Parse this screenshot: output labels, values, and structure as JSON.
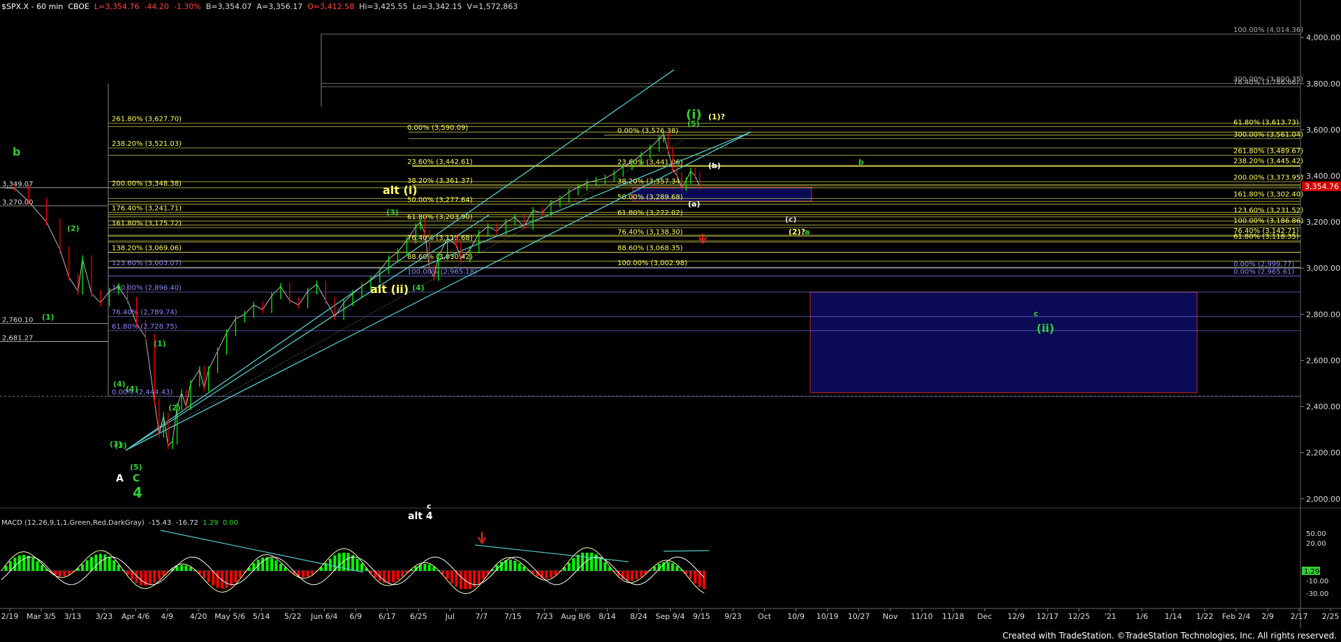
{
  "header": {
    "symbol": "$SPX.X - 60 min  CBOE",
    "last": "L=3,354.76",
    "change": "-44.20",
    "pct": "-1.30%",
    "bid": "B=3,354.07",
    "ask": "A=3,356.17",
    "open": "O=3,412.58",
    "high": "Hi=3,425.55",
    "low": "Lo=3,342.15",
    "volume": "V=1,572,863"
  },
  "macd": {
    "title": "MACD (12,26,9,1,1,Green,Red,DarkGray)",
    "v1": "-15.43",
    "v2": "-16.72",
    "v3": "1.29",
    "v4": "0.00",
    "axis_ticks": [
      "50.00",
      "20.00",
      "-10.00",
      "-30.00"
    ],
    "current_label": "1.29"
  },
  "footer": "Created with TradeStation. ©TradeStation Technologies, Inc. All rights reserved.",
  "colors": {
    "price_up": "#00ff00",
    "price_down": "#ff0000",
    "fib": "#ffff66",
    "fib_blue": "#8888ff",
    "cyan": "#55cccc",
    "wave_green": "#33cc33",
    "box_fill": "#0b0b55",
    "box_edge": "#cc2222"
  },
  "chart_data": {
    "type": "line",
    "x_ticks": [
      "2/19",
      "Mar 3/5",
      "3/13",
      "3/23",
      "Apr 4/6",
      "4/9",
      "4/20",
      "May 5/6",
      "5/14",
      "5/22",
      "Jun 6/4",
      "6/9",
      "6/17",
      "6/25",
      "Jul",
      "7/7",
      "7/15",
      "7/23",
      "Aug 8/6",
      "8/14",
      "8/24",
      "Sep 9/4",
      "9/15",
      "9/23",
      "Oct",
      "10/9",
      "10/19",
      "10/27",
      "Nov",
      "11/10",
      "11/18",
      "Dec",
      "12/9",
      "12/17",
      "12/25",
      "'21",
      "1/6",
      "1/14",
      "1/22",
      "Feb 2/4",
      "2/9",
      "2/17",
      "2/25"
    ],
    "y_ticks": [
      "4,000.00",
      "3,800.00",
      "3,600.00",
      "3,400.00",
      "3,200.00",
      "3,000.00",
      "2,800.00",
      "2,600.00",
      "2,400.00",
      "2,200.00",
      "2,000.00"
    ],
    "ylim": [
      1960,
      4120
    ],
    "last_price": "3,354.76",
    "price_path": [
      [
        0,
        3349
      ],
      [
        3,
        3345
      ],
      [
        6,
        3290
      ],
      [
        10,
        3200
      ],
      [
        13,
        3080
      ],
      [
        15,
        2960
      ],
      [
        17,
        2900
      ],
      [
        18,
        3040
      ],
      [
        20,
        2890
      ],
      [
        22,
        2850
      ],
      [
        24,
        2900
      ],
      [
        26,
        2920
      ],
      [
        28,
        2860
      ],
      [
        30,
        2760
      ],
      [
        32,
        2700
      ],
      [
        34,
        2420
      ],
      [
        35,
        2280
      ],
      [
        36,
        2360
      ],
      [
        37,
        2230
      ],
      [
        38,
        2250
      ],
      [
        39,
        2400
      ],
      [
        40,
        2460
      ],
      [
        41,
        2400
      ],
      [
        42,
        2500
      ],
      [
        44,
        2560
      ],
      [
        45,
        2480
      ],
      [
        46,
        2560
      ],
      [
        48,
        2640
      ],
      [
        50,
        2720
      ],
      [
        52,
        2780
      ],
      [
        54,
        2800
      ],
      [
        56,
        2840
      ],
      [
        58,
        2820
      ],
      [
        60,
        2880
      ],
      [
        62,
        2920
      ],
      [
        64,
        2860
      ],
      [
        66,
        2840
      ],
      [
        68,
        2900
      ],
      [
        70,
        2930
      ],
      [
        72,
        2860
      ],
      [
        74,
        2790
      ],
      [
        76,
        2850
      ],
      [
        78,
        2890
      ],
      [
        80,
        2920
      ],
      [
        82,
        2950
      ],
      [
        84,
        2990
      ],
      [
        86,
        3040
      ],
      [
        88,
        3070
      ],
      [
        90,
        3120
      ],
      [
        92,
        3180
      ],
      [
        93,
        3200
      ],
      [
        94,
        3150
      ],
      [
        95,
        3000
      ],
      [
        96,
        2960
      ],
      [
        97,
        3050
      ],
      [
        99,
        3130
      ],
      [
        101,
        3100
      ],
      [
        102,
        3040
      ],
      [
        104,
        3080
      ],
      [
        106,
        3150
      ],
      [
        108,
        3180
      ],
      [
        110,
        3160
      ],
      [
        112,
        3200
      ],
      [
        114,
        3220
      ],
      [
        116,
        3180
      ],
      [
        118,
        3250
      ],
      [
        120,
        3240
      ],
      [
        122,
        3280
      ],
      [
        124,
        3300
      ],
      [
        126,
        3330
      ],
      [
        128,
        3350
      ],
      [
        130,
        3370
      ],
      [
        132,
        3380
      ],
      [
        134,
        3390
      ],
      [
        136,
        3410
      ],
      [
        138,
        3440
      ],
      [
        140,
        3460
      ],
      [
        142,
        3490
      ],
      [
        144,
        3520
      ],
      [
        146,
        3560
      ],
      [
        147,
        3580
      ],
      [
        148,
        3510
      ],
      [
        149,
        3430
      ],
      [
        150,
        3400
      ],
      [
        151,
        3350
      ],
      [
        152,
        3380
      ],
      [
        153,
        3420
      ],
      [
        154,
        3400
      ],
      [
        155,
        3355
      ]
    ],
    "fib_levels": [
      {
        "label": "100.00% (4,014.36)",
        "value": 4014.36
      },
      {
        "label": "300.00% (3,800.35)",
        "value": 3800.35
      },
      {
        "label": "76.40% (3,786.66)",
        "value": 3786.66
      },
      {
        "label": "261.80% (3,627.70)",
        "value": 3627.7
      },
      {
        "label": "61.80% (3,613.73)",
        "value": 3613.73
      },
      {
        "label": "0.00% (3,590.09)",
        "value": 3590.09
      },
      {
        "label": "0.00% (3,576.38)",
        "value": 3576.38
      },
      {
        "label": "300.00% (3,561.04)",
        "value": 3561.04
      },
      {
        "label": "238.20% (3,521.03)",
        "value": 3521.03
      },
      {
        "label": "261.80% (3,489.67)",
        "value": 3489.67
      },
      {
        "label": "238.20% (3,445.42)",
        "value": 3445.42
      },
      {
        "label": "23.60% (3,442.61)",
        "value": 3442.61
      },
      {
        "label": "23.60% (3,441.06)",
        "value": 3441.06
      },
      {
        "label": "200.00% (3,373.95)",
        "value": 3373.95
      },
      {
        "label": "38.20% (3,361.37)",
        "value": 3361.37
      },
      {
        "label": "38.20% (3,357.34)",
        "value": 3357.34
      },
      {
        "label": "200.00% (3,348.38)",
        "value": 3348.38
      },
      {
        "label": "161.80% (3,302.40)",
        "value": 3302.4
      },
      {
        "label": "50.00% (3,289.68)",
        "value": 3289.68
      },
      {
        "label": "50.00% (3,277.64)",
        "value": 3277.64
      },
      {
        "label": "176.40% (3,241.71)",
        "value": 3241.71
      },
      {
        "label": "123.60% (3,231.52)",
        "value": 3231.52
      },
      {
        "label": "61.80% (3,222.02)",
        "value": 3222.02
      },
      {
        "label": "61.80% (3,203.90)",
        "value": 3203.9
      },
      {
        "label": "100.00% (3,186.86)",
        "value": 3186.86
      },
      {
        "label": "161.80% (3,175.72)",
        "value": 3175.72
      },
      {
        "label": "76.40% (3,142.71)",
        "value": 3142.71
      },
      {
        "label": "76.40% (3,138.30)",
        "value": 3138.3
      },
      {
        "label": "61.80% (3,118.35)",
        "value": 3118.35
      },
      {
        "label": "76.40% (3,112.68)",
        "value": 3112.68
      },
      {
        "label": "138.20% (3,069.06)",
        "value": 3069.06
      },
      {
        "label": "88.60% (3,068.35)",
        "value": 3068.35
      },
      {
        "label": "88.60% (3,030.42)",
        "value": 3030.42
      },
      {
        "label": "123.60% (3,003.07)",
        "value": 3003.07
      },
      {
        "label": "100.00% (3,002.98)",
        "value": 3002.98
      },
      {
        "label": "0.00% (2,999.77)",
        "value": 2999.77
      },
      {
        "label": "100.00% (2,965.18)",
        "value": 2965.18
      },
      {
        "label": "0.00% (2,965.61)",
        "value": 2965.61
      },
      {
        "label": "100.00% (2,896.40)",
        "value": 2896.4
      },
      {
        "label": "76.40% (2,789.74)",
        "value": 2789.74
      },
      {
        "label": "61.80% (2,728.75)",
        "value": 2728.75
      },
      {
        "label": "0.00% (2,444.43)",
        "value": 2444.43
      }
    ],
    "left_levels": [
      "3,349.07",
      "3,270.00",
      "2,760.10",
      "2,681.27"
    ],
    "wave_labels": [
      "b",
      "(2)",
      "(1)",
      "(3)",
      "(4)",
      "(5)",
      "A",
      "C",
      "4",
      "(1)",
      "(2)",
      "(3)",
      "(4)",
      "alt (i)",
      "alt (ii)",
      "(3)",
      "(4)",
      "c",
      "alt 4",
      "(i)",
      "(5)",
      "(1)?",
      "(b)",
      "(a)",
      "(c)",
      "(2)?",
      "a",
      "b",
      "c",
      "(ii)"
    ]
  }
}
